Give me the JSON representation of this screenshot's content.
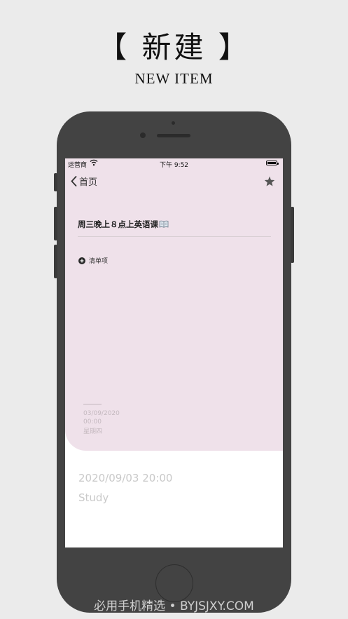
{
  "promo": {
    "title": "【 新建 】",
    "subtitle": "NEW ITEM"
  },
  "status_bar": {
    "carrier": "运营商",
    "time": "下午 9:52"
  },
  "nav": {
    "back_label": "首页",
    "back_icon": "chevron-left-icon",
    "favorite_icon": "star-icon"
  },
  "note": {
    "title": "周三晚上８点上英语课",
    "title_icon": "book-icon",
    "add_item_label": "清单项",
    "add_item_icon": "plus-circle-icon"
  },
  "meta": {
    "date": "03/09/2020",
    "time": "00:00",
    "weekday": "星期四"
  },
  "detail": {
    "datetime": "2020/09/03 20:00",
    "tag": "Study"
  },
  "watermark": "必用手机精选 • BYJSJXY.COM",
  "colors": {
    "background": "#ebebeb",
    "phone_body": "#434343",
    "card": "#efe1ea",
    "muted_text": "#c9c9c9"
  }
}
